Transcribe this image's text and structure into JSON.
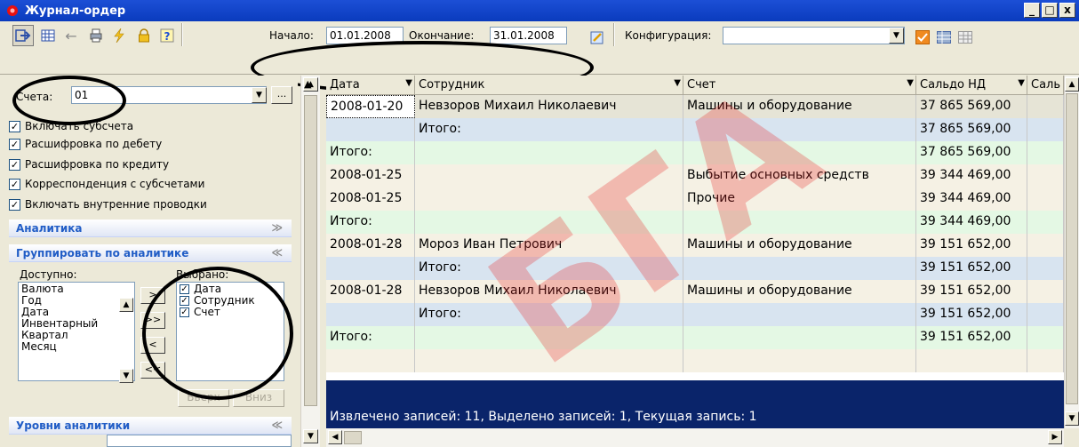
{
  "window": {
    "title": "Журнал-ордер",
    "buttons": [
      "_",
      "□",
      "x"
    ]
  },
  "toolbar": {
    "start_label": "Начало:",
    "start_value": "01.01.2008",
    "end_label": "Окончание:",
    "end_value": "31.01.2008",
    "config_label": "Конфигурация:",
    "config_value": ""
  },
  "left": {
    "account_label": "Счета:",
    "account_value": "01",
    "account_btn": "...",
    "options": [
      "Включать субсчета",
      "Расшифровка по дебету",
      "Расшифровка по кредиту",
      "Корреспонденция с субсчетами",
      "Включать внутренние проводки"
    ],
    "analytics_header": "Аналитика",
    "group_header": "Группировать по аналитике",
    "available_label": "Доступно:",
    "available_items": [
      "Валюта",
      "Год",
      "Дата",
      "Инвентарный",
      "Квартал",
      "Месяц"
    ],
    "selected_label": "Выбрано:",
    "selected_items": [
      "Дата",
      "Сотрудник",
      "Счет"
    ],
    "btn_add": ">",
    "btn_add_all": ">>",
    "btn_remove": "<",
    "btn_remove_all": "<<",
    "btn_up": "Вверх",
    "btn_down": "Вниз",
    "levels_header": "Уровни аналитики"
  },
  "grid": {
    "columns": [
      "Дата",
      "Сотрудник",
      "Счет",
      "Сальдо НД",
      "Саль"
    ],
    "rows": [
      [
        "2008-01-20",
        "Невзоров Михаил Николаевич",
        "Машины и оборудование",
        "37 865 569,00",
        ""
      ],
      [
        "",
        "Итого:",
        "",
        "37 865 569,00",
        ""
      ],
      [
        "Итого:",
        "",
        "",
        "37 865 569,00",
        ""
      ],
      [
        "2008-01-25",
        "",
        "Выбытие основных средств",
        "39 344 469,00",
        ""
      ],
      [
        "2008-01-25",
        "",
        "Прочие",
        "39 344 469,00",
        ""
      ],
      [
        "Итого:",
        "",
        "",
        "39 344 469,00",
        ""
      ],
      [
        "2008-01-28",
        "Мороз Иван Петрович",
        "Машины и оборудование",
        "39 151 652,00",
        ""
      ],
      [
        "",
        "Итого:",
        "",
        "39 151 652,00",
        ""
      ],
      [
        "2008-01-28",
        "Невзоров Михаил Николаевич",
        "Машины и оборудование",
        "39 151 652,00",
        ""
      ],
      [
        "",
        "Итого:",
        "",
        "39 151 652,00",
        ""
      ],
      [
        "Итого:",
        "",
        "",
        "39 151 652,00",
        ""
      ],
      [
        "",
        "",
        "",
        "",
        ""
      ]
    ],
    "status": "Извлечено записей: 11, Выделено записей: 1, Текущая запись: 1"
  },
  "colors": {
    "title_bar": "#0a3bbd",
    "row_olive": "#e6e4d6",
    "row_blue": "#d8e4f0",
    "row_green": "#e4f8e4",
    "row_beige": "#f5f1e4",
    "selection": "#0a246a"
  }
}
